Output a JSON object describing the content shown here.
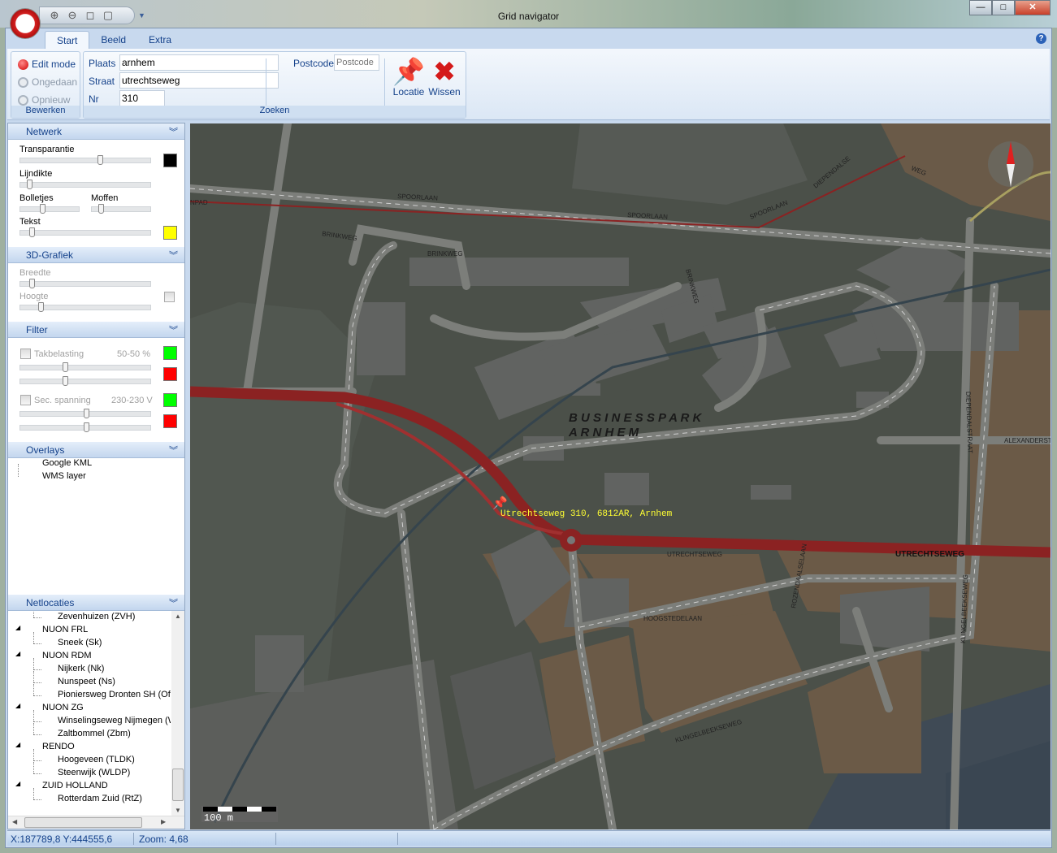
{
  "window": {
    "title": "Grid navigator",
    "minimize": "—",
    "maximize": "□",
    "close": "✕"
  },
  "quick_access": [
    "zoom-in-icon",
    "zoom-out-icon",
    "zoom-extent-icon",
    "zoom-window-icon"
  ],
  "tabs": [
    {
      "label": "Start",
      "active": true
    },
    {
      "label": "Beeld"
    },
    {
      "label": "Extra"
    }
  ],
  "ribbon": {
    "bewerken": {
      "label": "Bewerken",
      "edit_mode": "Edit mode",
      "undo": "Ongedaan",
      "redo": "Opnieuw"
    },
    "zoeken": {
      "label": "Zoeken",
      "plaats_label": "Plaats",
      "plaats_value": "arnhem",
      "straat_label": "Straat",
      "straat_value": "utrechtseweg",
      "nr_label": "Nr",
      "nr_value": "310",
      "postcode_label": "Postcode",
      "postcode_placeholder": "Postcode",
      "locatie": "Locatie",
      "wissen": "Wissen"
    }
  },
  "panels": {
    "netwerk": {
      "title": "Netwerk",
      "transparantie": "Transparantie",
      "lijndikte": "Lijndikte",
      "bolletjes": "Bolletjes",
      "moffen": "Moffen",
      "tekst": "Tekst",
      "transparantie_color": "#000000",
      "tekst_color": "#ffff00"
    },
    "grafiek": {
      "title": "3D-Grafiek",
      "breedte": "Breedte",
      "hoogte": "Hoogte"
    },
    "filter": {
      "title": "Filter",
      "takbelasting": "Takbelasting",
      "takbelasting_range": "50-50 %",
      "sec_spanning": "Sec. spanning",
      "sec_spanning_range": "230-230 V",
      "low_color": "#00ff00",
      "high_color": "#ff0000"
    },
    "overlays": {
      "title": "Overlays",
      "items": [
        "Google KML",
        "WMS layer"
      ]
    },
    "netlocaties": {
      "title": "Netlocaties",
      "items": [
        {
          "label": "Zevenhuizen (ZVH)",
          "level": 2
        },
        {
          "label": "NUON FRL",
          "level": 1
        },
        {
          "label": "Sneek (Sk)",
          "level": 2
        },
        {
          "label": "NUON RDM",
          "level": 1
        },
        {
          "label": "Nijkerk (Nk)",
          "level": 2
        },
        {
          "label": "Nunspeet (Ns)",
          "level": 2
        },
        {
          "label": "Pioniersweg Dronten SH (Ofd",
          "level": 2
        },
        {
          "label": "NUON ZG",
          "level": 1
        },
        {
          "label": "Winselingseweg Nijmegen (W",
          "level": 2
        },
        {
          "label": "Zaltbommel (Zbm)",
          "level": 2
        },
        {
          "label": "RENDO",
          "level": 1
        },
        {
          "label": "Hoogeveen (TLDK)",
          "level": 2
        },
        {
          "label": "Steenwijk (WLDP)",
          "level": 2
        },
        {
          "label": "ZUID HOLLAND",
          "level": 1
        },
        {
          "label": "Rotterdam Zuid (RtZ)",
          "level": 2
        }
      ]
    }
  },
  "map": {
    "location_label": "Utrechtseweg 310, 6812AR, Arnhem",
    "area_label_1": "B U S I N E S S P A R K",
    "area_label_2": "A R N H E M",
    "streets": {
      "spoorlaan": "SPOORLAAN",
      "brinkweg": "BRINKWEG",
      "utrechtseweg": "UTRECHTSEWEG",
      "hoogstedelaan": "HOOGSTEDELAAN",
      "klingelbeekseweg": "KLINGELBEEKSEWEG",
      "alexanderstraat": "ALEXANDERSTR",
      "dependalstraat": "DIEPENDALSTRAAT",
      "dependalse": "DIEPENDALSE",
      "weg": "WEG",
      "rozendaalselaan": "ROZENDAALSELAAN",
      "npad": "NPAD"
    },
    "scale_label": "100 m",
    "road_color": "#8b2222"
  },
  "status": {
    "coords": "X:187789,8 Y:444555,6",
    "zoom": "Zoom: 4,68"
  }
}
